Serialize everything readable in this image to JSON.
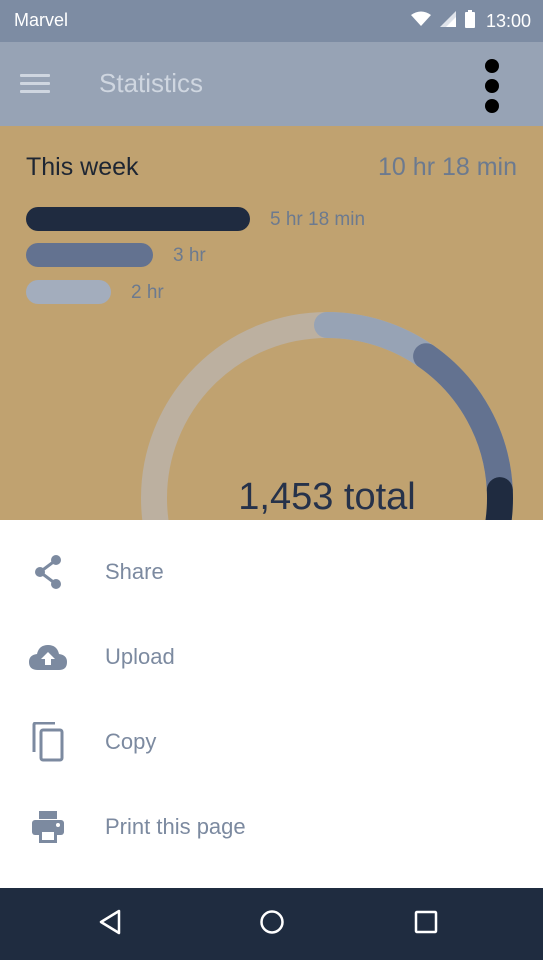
{
  "status_bar": {
    "carrier": "Marvel",
    "time": "13:00"
  },
  "app_bar": {
    "title": "Statistics"
  },
  "stats": {
    "period_label": "This week",
    "period_total": "10 hr 18 min",
    "bars": [
      {
        "label": "5 hr 18 min",
        "minutes": 318,
        "color": "#1f2b40"
      },
      {
        "label": "3 hr",
        "minutes": 180,
        "color": "#637290"
      },
      {
        "label": "2 hr",
        "minutes": 120,
        "color": "#a3adbd"
      }
    ],
    "donut_total": "1,453 total",
    "donut_colors": {
      "track": "#bcb0a0",
      "segments": [
        "#97a3b5",
        "#637290",
        "#1f2b40"
      ]
    }
  },
  "sheet": {
    "items": [
      {
        "label": "Share",
        "icon": "share-icon"
      },
      {
        "label": "Upload",
        "icon": "cloud-upload-icon"
      },
      {
        "label": "Copy",
        "icon": "copy-icon"
      },
      {
        "label": "Print this page",
        "icon": "print-icon"
      }
    ]
  },
  "nav_bar": {
    "buttons": [
      "back-icon",
      "home-icon",
      "recents-icon"
    ]
  }
}
